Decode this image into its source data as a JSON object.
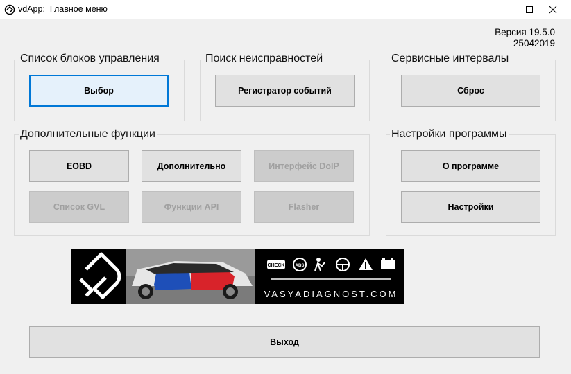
{
  "window": {
    "app_name": "vdApp:",
    "title": "Главное меню"
  },
  "version": {
    "label": "Версия 19.5.0",
    "build": "25042019"
  },
  "groups": {
    "control_units": {
      "title": "Список блоков управления",
      "select_button": "Выбор"
    },
    "faults": {
      "title": "Поиск неисправностей",
      "event_recorder_button": "Регистратор событий"
    },
    "service": {
      "title": "Сервисные интервалы",
      "reset_button": "Сброс"
    },
    "extra": {
      "title": "Дополнительные функции",
      "eobd_button": "EOBD",
      "additional_button": "Дополнительно",
      "doip_button": "Интерфейс DoIP",
      "gvl_button": "Список GVL",
      "api_button": "Функции API",
      "flasher_button": "Flasher"
    },
    "settings": {
      "title": "Настройки программы",
      "about_button": "О программе",
      "settings_button": "Настройки"
    }
  },
  "banner": {
    "text": "VASYADIAGNOST.COM",
    "check_label": "CHECK",
    "abs_label": "ABS"
  },
  "exit_button": "Выход",
  "colors": {
    "focus": "#0078d7",
    "accent_red": "#d8232a",
    "accent_blue": "#1e4fb8"
  }
}
